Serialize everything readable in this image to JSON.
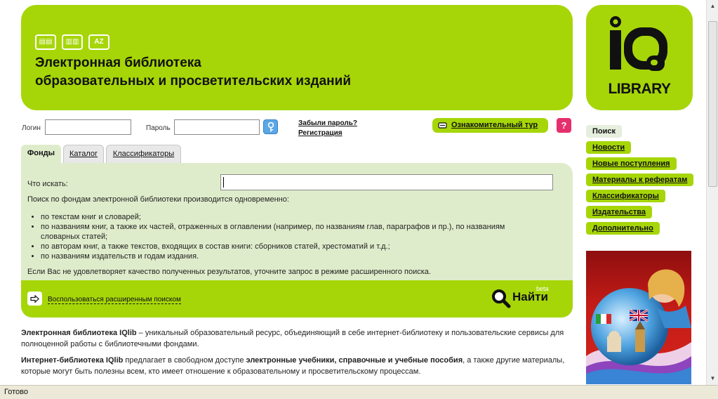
{
  "header": {
    "title_line1": "Электронная библиотека",
    "title_line2": "образовательных и просветительских изданий",
    "mode_icons": [
      {
        "icon": "book-open-icon",
        "glyph": "▤▤"
      },
      {
        "icon": "bookshelf-icon",
        "glyph": "▥▥"
      },
      {
        "icon": "az-index-icon",
        "glyph": "AZ"
      }
    ]
  },
  "logo": {
    "icon": "iq-logo-icon",
    "text": "LIBRARY"
  },
  "login": {
    "login_label": "Логин",
    "login_value": "",
    "password_label": "Пароль",
    "password_value": "",
    "submit_icon": "key-icon",
    "forgot_password": "Забыли пароль?",
    "register": "Регистрация"
  },
  "tour": {
    "label": "Ознакомительный тур",
    "icon": "pencil-icon"
  },
  "help": {
    "label": "?",
    "icon": "help-icon"
  },
  "tabs": [
    {
      "label": "Фонды",
      "active": true
    },
    {
      "label": "Каталог",
      "active": false
    },
    {
      "label": "Классификаторы",
      "active": false
    }
  ],
  "search": {
    "query_label": "Что искать:",
    "query_value": "",
    "intro": "Поиск по фондам электронной библиотеки производится одновременно:",
    "items": [
      "по текстам книг и словарей;",
      "по названиям книг, а также их частей, отраженных в оглавлении (например, по названиям глав, параграфов и пр.), по названиям словарных статей;",
      "по авторам книг, а также текстов, входящих в состав книги: сборников статей, хрестоматий и т.д.;",
      "по названиям издательств и годам издания."
    ],
    "advice": "Если Вас не удовлетворяет качество полученных результатов, уточните запрос в режиме расширенного поиска.",
    "advanced_link": "Воспользоваться расширенным поиском",
    "find_button": "Найти",
    "find_badge": "beta"
  },
  "content": {
    "para1_bold": "Электронная библиотека IQlib",
    "para1_rest": " – уникальный образовательный ресурс, объединяющий в себе интернет-библиотеку и пользовательские сервисы для полноценной работы с библиотечными фондами.",
    "para2_bold1": "Интернет-библиотека IQlib",
    "para2_mid": " предлагает в свободном доступе ",
    "para2_bold2": "электронные учебники, справочные и учебные пособия",
    "para2_rest": ", а также другие материалы, которые могут быть полезны всем, кто имеет отношение к образовательному и просветительскому процессам."
  },
  "nav": [
    {
      "label": "Поиск",
      "current": true
    },
    {
      "label": "Новости",
      "current": false
    },
    {
      "label": "Новые поступления",
      "current": false
    },
    {
      "label": "Материалы к рефератам",
      "current": false
    },
    {
      "label": "Классификаторы",
      "current": false
    },
    {
      "label": "Издательства",
      "current": false
    },
    {
      "label": "Дополнительно",
      "current": false
    }
  ],
  "status": {
    "text": "Готово"
  },
  "colors": {
    "accent": "#a6d608",
    "panel": "#dfeccb",
    "help": "#e62f6d",
    "key": "#5aa7e6"
  }
}
